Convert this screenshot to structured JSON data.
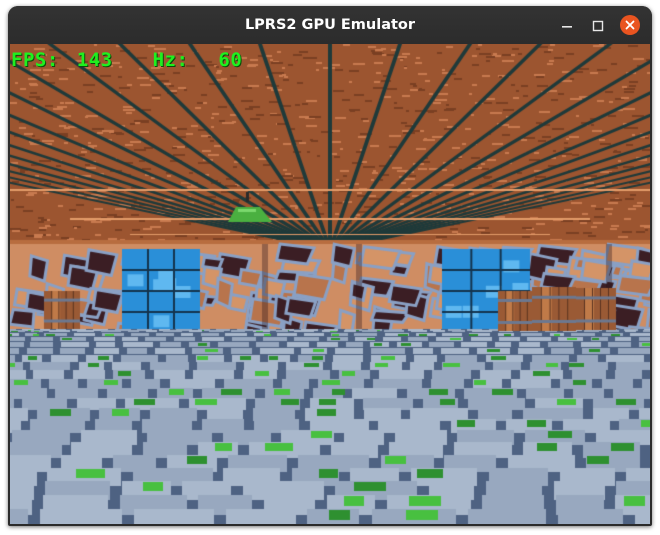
{
  "window": {
    "title": "LPRS2 GPU Emulator"
  },
  "controls": {
    "minimize": "minimize-icon",
    "maximize": "maximize-icon",
    "close": "close-icon"
  },
  "hud": {
    "fps_label": "FPS:",
    "fps_value": "143",
    "hz_label": "Hz:",
    "hz_value": "60"
  },
  "scene": {
    "ceiling": "#9c5530",
    "ceiling_light": "#c87a4f",
    "beam": "#1f3a3a",
    "wall_base": "#cf8d63",
    "wall_dark": "#3b1e24",
    "wall_mortar": "#8aa0c4",
    "blue_panel": "#2a8fd8",
    "floor": "#4e6282",
    "tile": "#a9b8cc",
    "moss": "#48c040",
    "lamp": "#4ab040",
    "barrel": "#9a5a35"
  }
}
